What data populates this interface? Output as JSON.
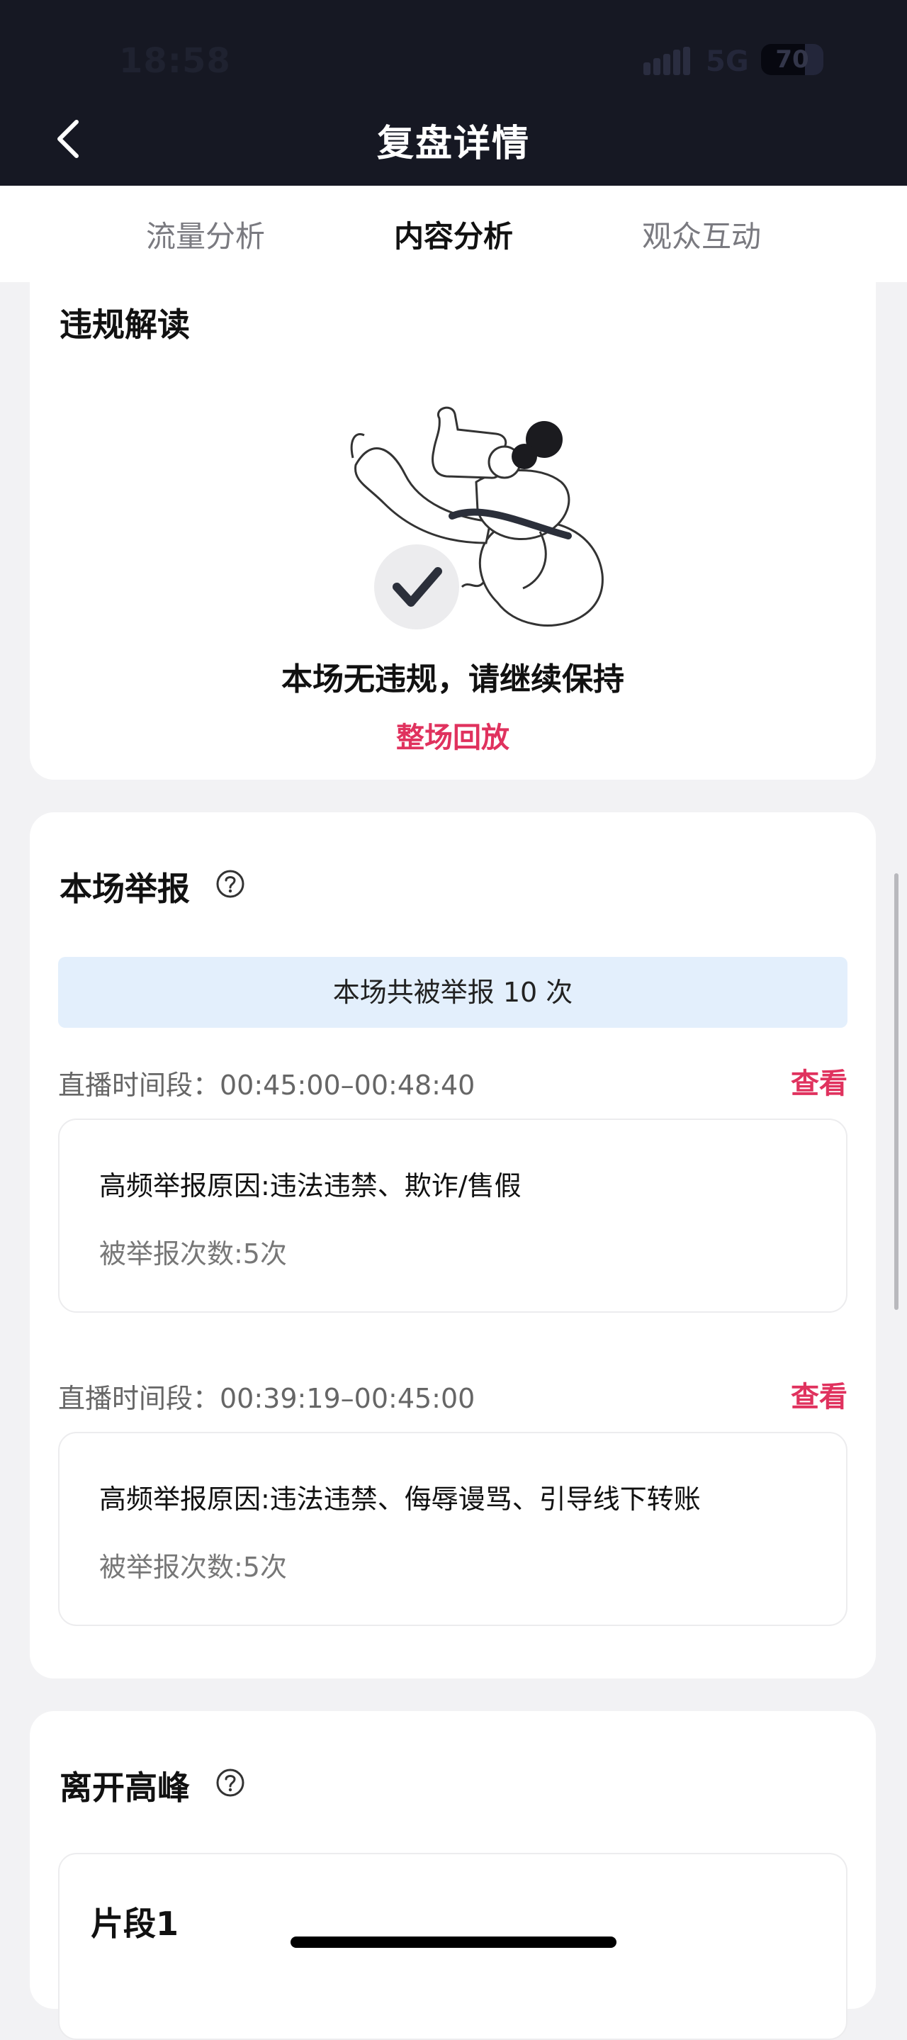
{
  "status_bar": {
    "time": "18:58",
    "network": "5G",
    "battery": "70",
    "battery_level": 0.7
  },
  "nav": {
    "title": "复盘详情",
    "back_icon": "chevron-left-icon"
  },
  "tabs": [
    {
      "label": "流量分析",
      "active": false
    },
    {
      "label": "内容分析",
      "active": true
    },
    {
      "label": "观众互动",
      "active": false
    }
  ],
  "violation": {
    "title": "违规解读",
    "illustration": "thumbs-up-check-illustration",
    "message": "本场无违规，请继续保持",
    "replay_link": "整场回放"
  },
  "reports": {
    "title": "本场举报",
    "help_icon": "question-circle-icon",
    "summary": "本场共被举报 10 次",
    "items": [
      {
        "period": "直播时间段：00:45:00–00:48:40",
        "view_link": "查看",
        "reason": "高频举报原因:违法违禁、欺诈/售假",
        "count": "被举报次数:5次"
      },
      {
        "period": "直播时间段：00:39:19–00:45:00",
        "view_link": "查看",
        "reason": "高频举报原因:违法违禁、侮辱谩骂、引导线下转账",
        "count": "被举报次数:5次"
      }
    ]
  },
  "leave_peak": {
    "title": "离开高峰",
    "help_icon": "question-circle-icon",
    "segment_title": "片段1"
  },
  "colors": {
    "accent": "#e0325e",
    "header_bg": "#161823",
    "banner_bg": "#e3effc",
    "page_bg": "#f2f2f4"
  }
}
